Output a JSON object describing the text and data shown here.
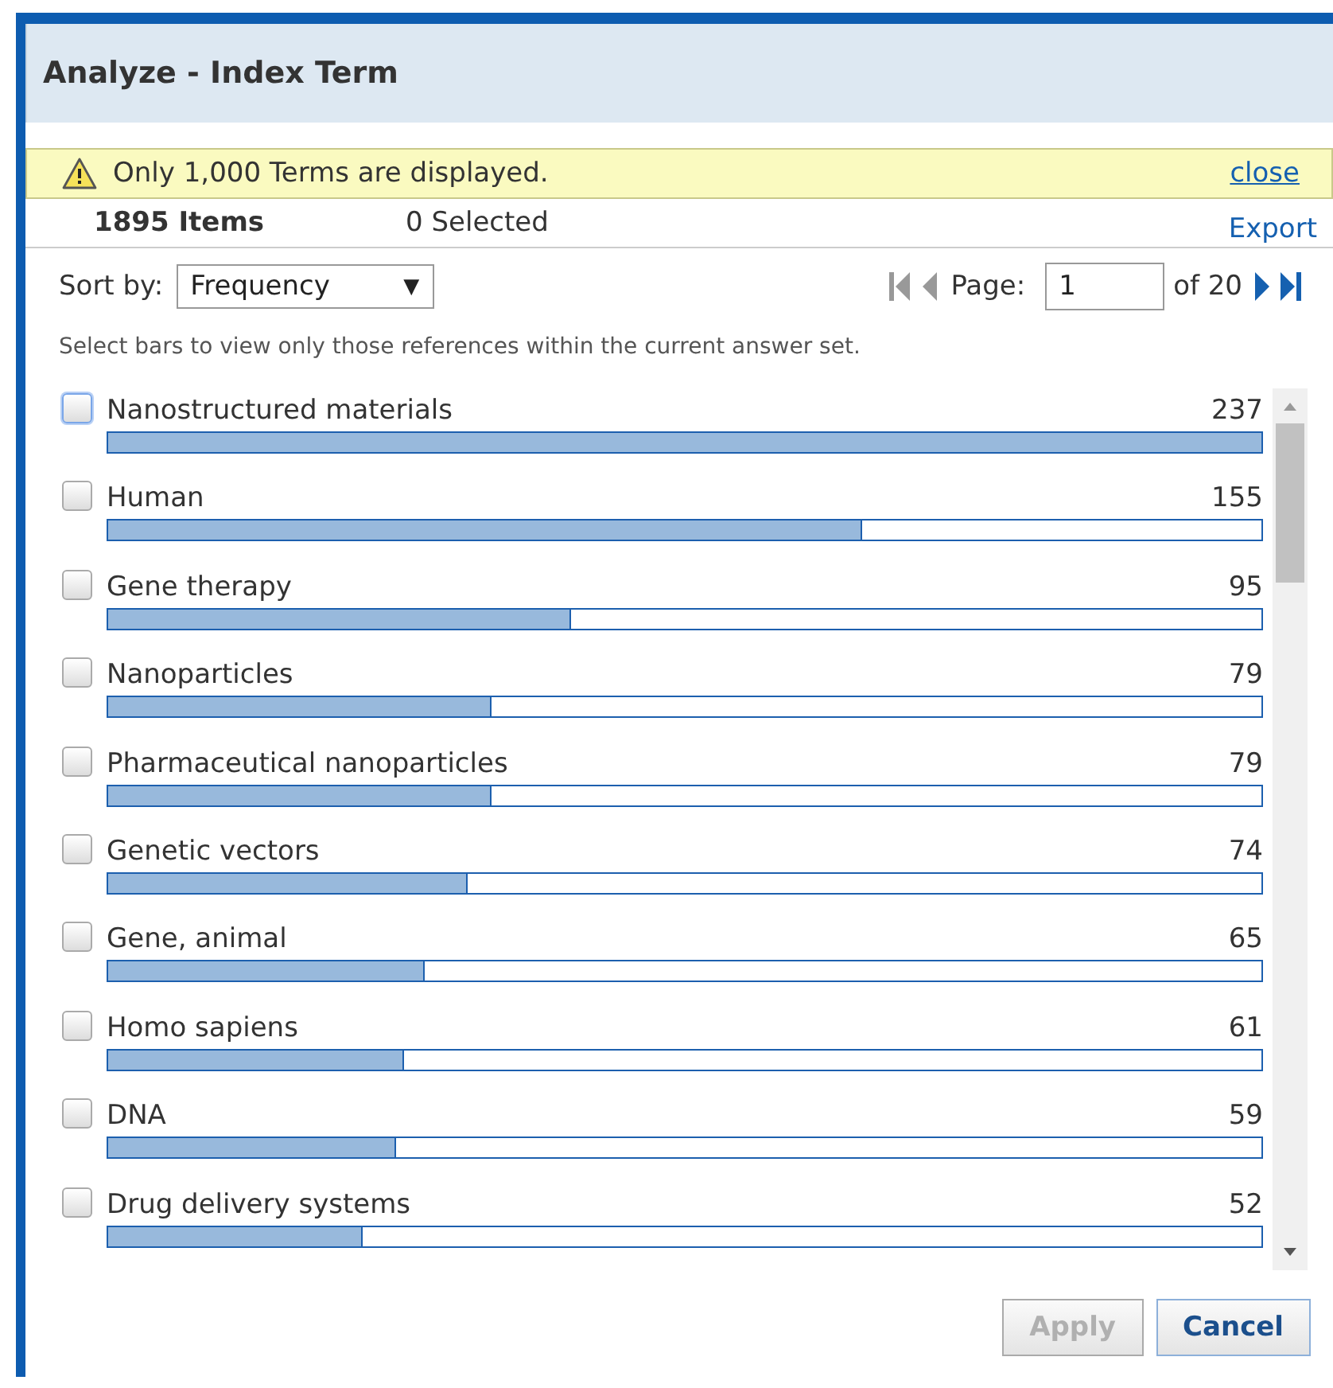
{
  "dialog": {
    "title": "Analyze - Index Term"
  },
  "notice": {
    "text": "Only 1,000 Terms are displayed.",
    "close": "close"
  },
  "summary": {
    "items": "1895 Items",
    "selected": "0 Selected",
    "export": "Export"
  },
  "sort": {
    "label": "Sort by:",
    "value": "Frequency",
    "caret": "▼"
  },
  "pager": {
    "label": "Page:",
    "value": "1",
    "of": "of 20"
  },
  "hint": "Select bars to view only those references within the current answer set.",
  "terms": [
    {
      "name": "Nanostructured materials",
      "count": "237",
      "level": 1.0,
      "checked": false,
      "focused": true
    },
    {
      "name": "Human",
      "count": "155",
      "level": 0.654,
      "checked": false,
      "focused": false
    },
    {
      "name": "Gene therapy",
      "count": "95",
      "level": 0.401,
      "checked": false,
      "focused": false
    },
    {
      "name": "Nanoparticles",
      "count": "79",
      "level": 0.333,
      "checked": false,
      "focused": false
    },
    {
      "name": "Pharmaceutical nanoparticles",
      "count": "79",
      "level": 0.333,
      "checked": false,
      "focused": false
    },
    {
      "name": "Genetic vectors",
      "count": "74",
      "level": 0.312,
      "checked": false,
      "focused": false
    },
    {
      "name": "Gene, animal",
      "count": "65",
      "level": 0.274,
      "checked": false,
      "focused": false
    },
    {
      "name": "Homo sapiens",
      "count": "61",
      "level": 0.257,
      "checked": false,
      "focused": false
    },
    {
      "name": "DNA",
      "count": "59",
      "level": 0.249,
      "checked": false,
      "focused": false
    },
    {
      "name": "Drug delivery systems",
      "count": "52",
      "level": 0.221,
      "checked": false,
      "focused": false
    }
  ],
  "buttons": [
    {
      "label": "Apply",
      "disabled": true
    },
    {
      "label": "Cancel",
      "disabled": false
    }
  ]
}
